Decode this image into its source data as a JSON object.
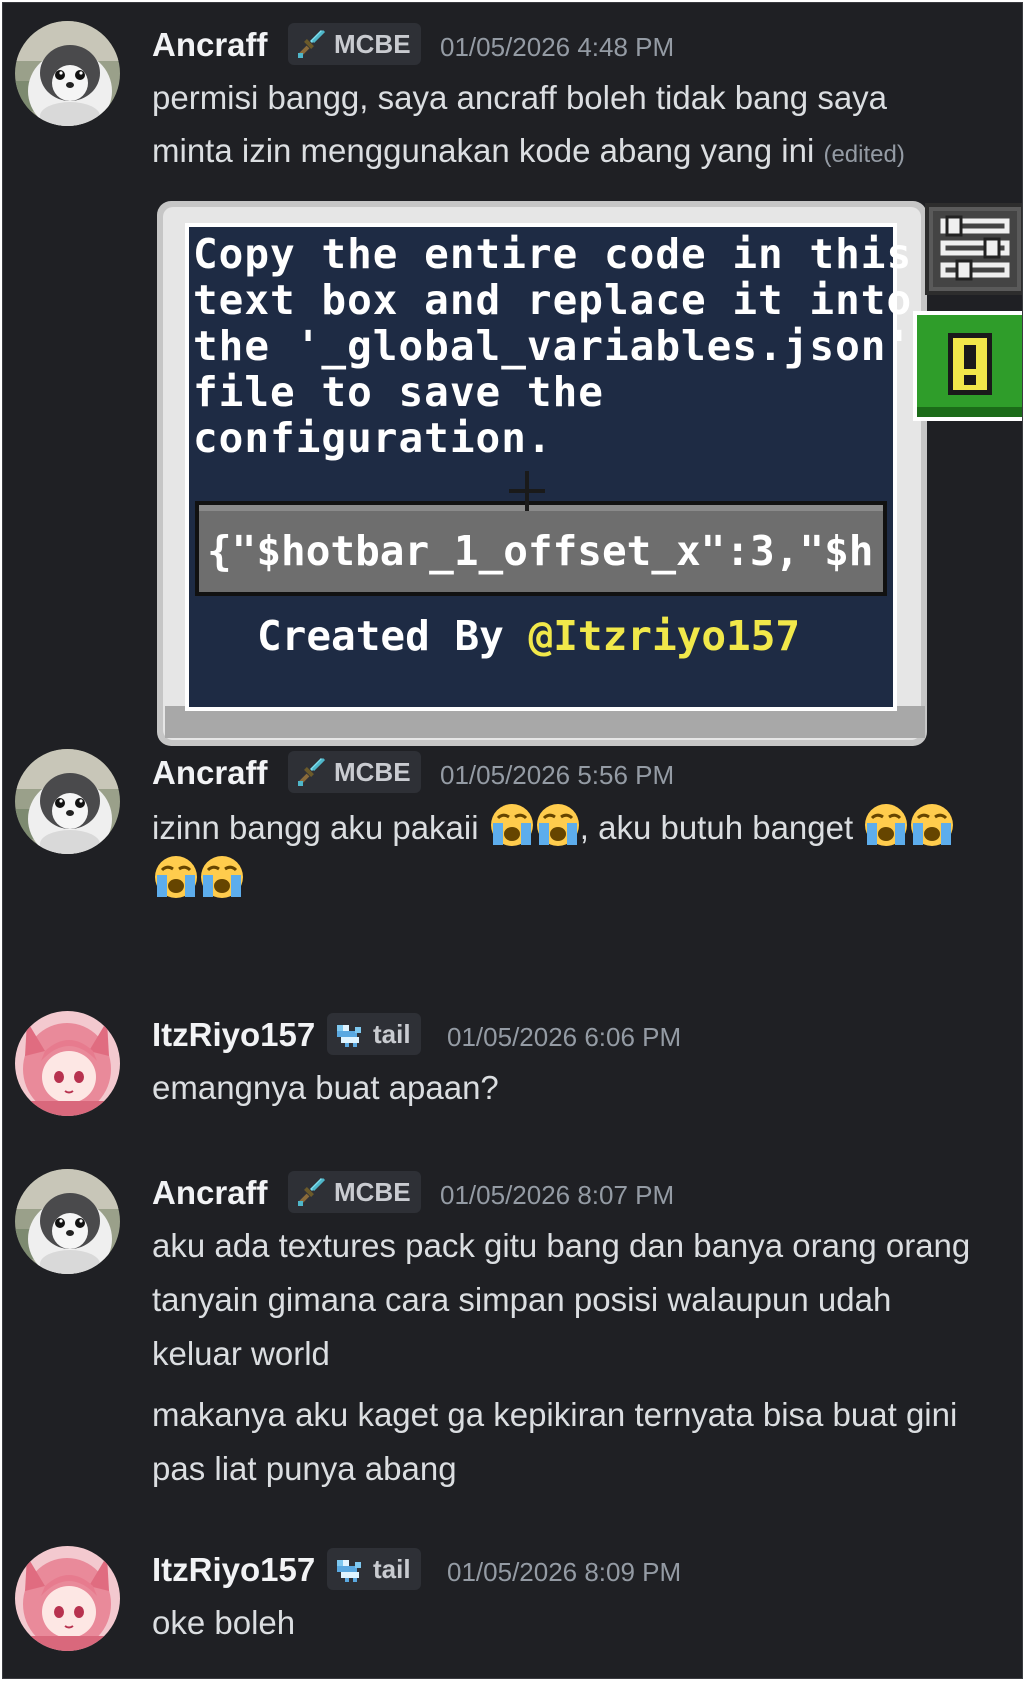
{
  "messages": [
    {
      "username": "Ancraff",
      "tag": "MCBE",
      "time": "01/05/2026 4:48 PM",
      "lines": [
        "permisi bangg, saya ancraff boleh tidak bang saya",
        "minta izin menggunakan kode abang yang ini"
      ],
      "edited": "(edited)"
    },
    {
      "username": "Ancraff",
      "tag": "MCBE",
      "time": "01/05/2026 5:56 PM",
      "text_a": "izinn bangg aku pakaii",
      "text_b": ", aku butuh banget"
    },
    {
      "username": "ItzRiyo157",
      "tag": "tail",
      "time": "01/05/2026 6:06 PM",
      "lines": [
        "emangnya buat apaan?"
      ]
    },
    {
      "username": "Ancraff",
      "tag": "MCBE",
      "time": "01/05/2026 8:07 PM",
      "lines": [
        "aku ada textures pack gitu bang dan banya orang orang",
        "tanyain gimana cara simpan posisi walaupun udah",
        "keluar world",
        "makanya aku kaget ga kepikiran ternyata bisa buat gini",
        "pas liat punya abang"
      ]
    },
    {
      "username": "ItzRiyo157",
      "tag": "tail",
      "time": "01/05/2026 8:09 PM",
      "lines": [
        "oke boleh"
      ]
    }
  ],
  "embed": {
    "lines": [
      "Copy the entire code in this",
      "text box and replace it into",
      "the '_global_variables.json'",
      "file to save the",
      "configuration."
    ],
    "code_value": "{\"$hotbar_1_offset_x\":3,\"$h",
    "credit_prefix": "Created By ",
    "credit_handle": "@Itzriyo157"
  },
  "icons": {
    "tag_mcbe": "diamond-sword-icon",
    "tag_tail": "pixel-fox-icon",
    "emoji": "loudly-crying-face-emoji",
    "settings": "sliders-icon",
    "alert": "exclamation-icon"
  },
  "colors": {
    "background": "#1f2024",
    "username": "#f2f3f5",
    "text": "#dbdee1",
    "muted": "#949ba4",
    "tag_bg": "#2e3036",
    "mc_panel": "#1e2b44",
    "mc_highlight": "#f1e84a",
    "alert_green": "#2f9d2a"
  }
}
